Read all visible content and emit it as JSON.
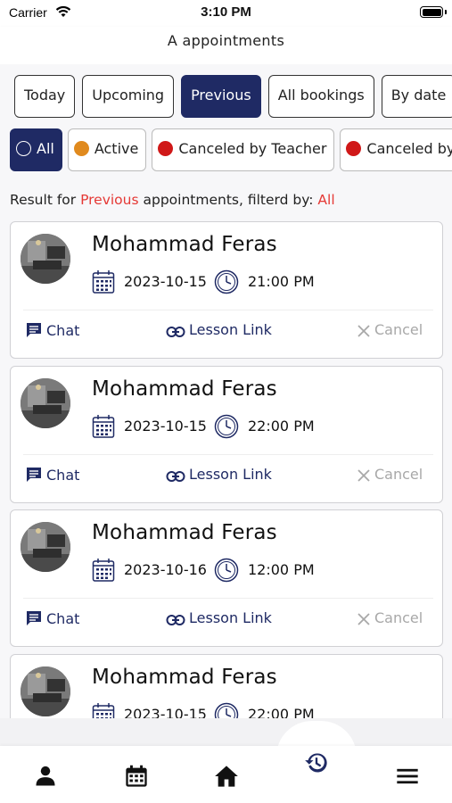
{
  "status_bar": {
    "carrier": "Carrier",
    "time": "3:10 PM"
  },
  "header": {
    "title": "A appointments"
  },
  "tabs": [
    {
      "label": "Today",
      "active": false
    },
    {
      "label": "Upcoming",
      "active": false
    },
    {
      "label": "Previous",
      "active": true
    },
    {
      "label": "All bookings",
      "active": false
    },
    {
      "label": "By date",
      "active": false
    }
  ],
  "filters": [
    {
      "label": "All",
      "color": "hollow",
      "active": true
    },
    {
      "label": "Active",
      "color": "#e08a1e",
      "active": false
    },
    {
      "label": "Canceled by Teacher",
      "color": "#d01818",
      "active": false
    },
    {
      "label": "Canceled by Student",
      "color": "#d01818",
      "active": false
    }
  ],
  "result": {
    "prefix": "Result for ",
    "tab": "Previous",
    "middle": " appointments, filterd by: ",
    "filter": "All"
  },
  "appointments": [
    {
      "name": "Mohammad Feras",
      "date": "2023-10-15",
      "time": "21:00 PM"
    },
    {
      "name": "Mohammad Feras",
      "date": "2023-10-15",
      "time": "22:00 PM"
    },
    {
      "name": "Mohammad Feras",
      "date": "2023-10-16",
      "time": "12:00 PM"
    },
    {
      "name": "Mohammad Feras",
      "date": "2023-10-15",
      "time": "22:00 PM"
    }
  ],
  "actions": {
    "chat": "Chat",
    "lesson_link": "Lesson Link",
    "cancel": "Cancel"
  },
  "bottom_nav": [
    {
      "icon": "person-icon",
      "active": false
    },
    {
      "icon": "calendar-icon",
      "active": false
    },
    {
      "icon": "home-icon",
      "active": false
    },
    {
      "icon": "history-icon",
      "active": true
    },
    {
      "icon": "menu-icon",
      "active": false
    }
  ],
  "colors": {
    "primary": "#1f2a64",
    "highlight": "#e53935",
    "muted": "#a8a8a8"
  }
}
